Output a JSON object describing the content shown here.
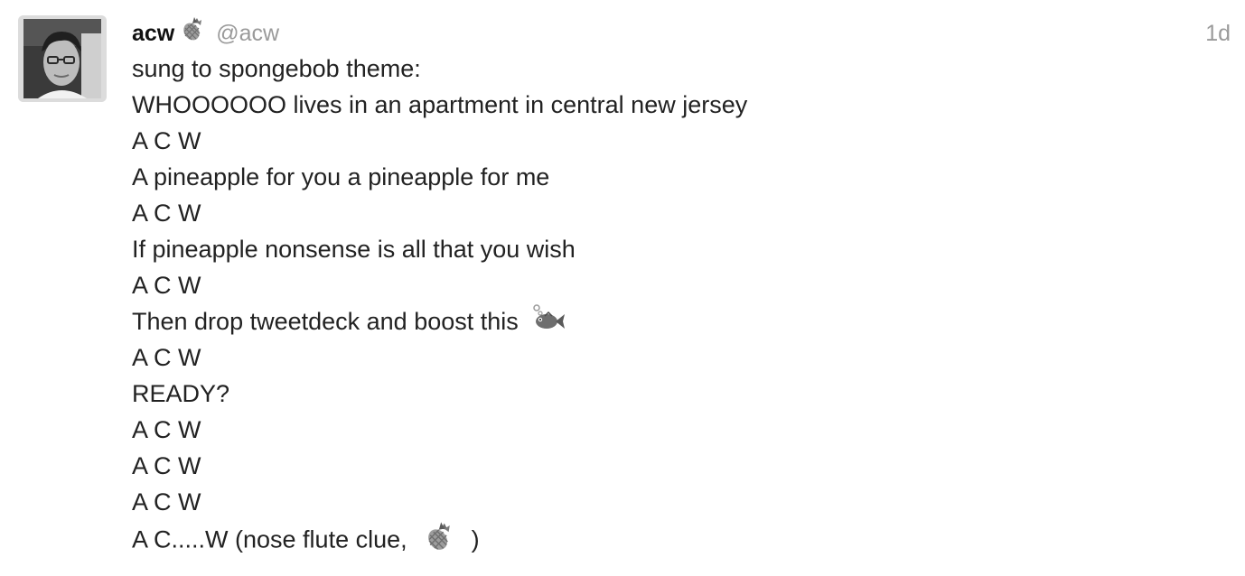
{
  "status": {
    "author": {
      "display_name": "acw",
      "name_emoji": "pineapple-icon",
      "handle": "@acw"
    },
    "timestamp": "1d",
    "lines": [
      "sung to spongebob theme:",
      "WHOOOOOO lives in an apartment in central new jersey",
      "A C W",
      "A pineapple for you a pineapple for me",
      "A C W",
      "If pineapple nonsense is all that you wish",
      "A C W",
      "Then drop tweetdeck and boost this",
      "A C W",
      "READY?",
      "A C W",
      "A C W",
      "A C W",
      "A C.....W (nose flute clue,",
      ")"
    ],
    "inline_emojis": [
      "fish-icon",
      "pineapple-icon"
    ]
  },
  "colors": {
    "text": "#222222",
    "muted": "#9a9a9a",
    "background": "#ffffff"
  }
}
